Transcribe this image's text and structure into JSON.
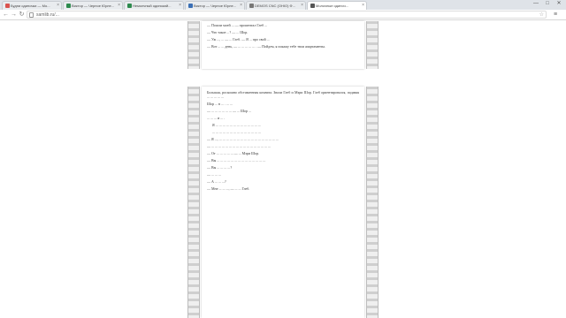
{
  "browser": {
    "tabs": [
      {
        "label": "Будни одиночки — Мо...",
        "active": false,
        "fav_color": "#d9534f"
      },
      {
        "label": "Виктор — Черное Юрле...",
        "active": false,
        "fav_color": "#2d8a4e"
      },
      {
        "label": "Немолчный одинокий...",
        "active": false,
        "fav_color": "#2d8a4e"
      },
      {
        "label": "Виктор — Черное Юрле...",
        "active": false,
        "fav_color": "#3a6fb5"
      },
      {
        "label": "DEMOS CNC (OHIO) Ф...",
        "active": false,
        "fav_color": "#777777"
      },
      {
        "label": "Молочные одиноч...",
        "active": true,
        "fav_color": "#555555"
      }
    ],
    "url": "samlib.ru/...",
    "window_controls": [
      "—",
      "□",
      "✕"
    ]
  },
  "reader": {
    "top_page_paragraphs": [
      "— Пошли моей ... — прошептал Глеб ...",
      "— Что такое ...? — ... Шор.",
      "— Уж ..., ... — ... Глеб. — Я ... про свой ...",
      "— Вот ... ... день, — ... ... ... ... ... . — Пойдем, я покажу тебе твои апартаменты."
    ],
    "bottom_page_paragraphs": [
      "Большая, роскошно обставленная комната. Звали Глеб и Мэри Шор. Глеб ориентировался, подавая ... ... ... ... ...",
      "Шор ... в ... . ... ...",
      "— ... ... ... ... ... ... — ... Шор ...",
      "... ... ... и ... .",
      "Я ... ... ... ... ... ... ... ... ... ... ... ... ...",
      "... ... ... ... ... ... ... ... ... ... ... ... ... ...",
      "— Я ..., ... ... ... ... ... ... ... ... ... ... ... ... ... ... ... ... ...",
      "— ... ... ... ... ... ... ... ... ... ... ... ... ... ... ... ... ...",
      "— От ... ... ... ... ... — ... Мэри Шор.",
      "— Вы ... ... ... ... ... ... ... ... ... ... ... ... ... ...",
      "— Вы ... ... ... ...?",
      "— ... ... ...",
      "— А ... ... ...?",
      "— Мне ... ... ..., — ... ... Глеб."
    ]
  }
}
